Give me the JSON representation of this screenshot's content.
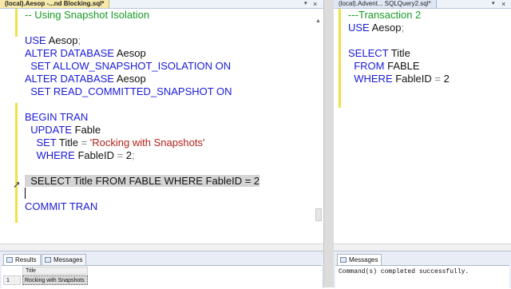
{
  "left_editor": {
    "tab_title": "(local).Aesop -...nd Blocking.sql*",
    "lines": [
      [
        {
          "t": "-- Using Snapshot Isolation",
          "c": "cm"
        }
      ],
      [],
      [
        {
          "t": "USE",
          "c": "kw"
        },
        {
          "t": " Aesop",
          "c": "id"
        },
        {
          "t": ";",
          "c": "op"
        }
      ],
      [
        {
          "t": "ALTER DATABASE",
          "c": "kw"
        },
        {
          "t": " Aesop",
          "c": "id"
        }
      ],
      [
        {
          "t": "  SET ALLOW_SNAPSHOT_ISOLATION ON",
          "c": "kw"
        }
      ],
      [
        {
          "t": "ALTER DATABASE",
          "c": "kw"
        },
        {
          "t": " Aesop",
          "c": "id"
        }
      ],
      [
        {
          "t": "  SET READ_COMMITTED_SNAPSHOT ON",
          "c": "kw"
        }
      ],
      [],
      [
        {
          "t": "BEGIN TRAN",
          "c": "kw"
        }
      ],
      [
        {
          "t": "  UPDATE",
          "c": "kw"
        },
        {
          "t": " Fable",
          "c": "id"
        }
      ],
      [
        {
          "t": "    SET",
          "c": "kw"
        },
        {
          "t": " Title ",
          "c": "id"
        },
        {
          "t": "=",
          "c": "op"
        },
        {
          "t": " 'Rocking with Snapshots'",
          "c": "st"
        }
      ],
      [
        {
          "t": "    WHERE",
          "c": "kw"
        },
        {
          "t": " FableID ",
          "c": "id"
        },
        {
          "t": "=",
          "c": "op"
        },
        {
          "t": " 2",
          "c": "id"
        },
        {
          "t": ";",
          "c": "op"
        }
      ],
      [],
      [
        {
          "t": "  SELECT Title FROM FABLE WHERE FableID = 2",
          "c": "id",
          "sel": true
        }
      ],
      [],
      [
        {
          "t": "COMMIT TRAN",
          "c": "kw"
        }
      ]
    ]
  },
  "right_editor": {
    "tab_title": "(local).Advent... SQLQuery2.sql*",
    "lines": [
      [
        {
          "t": "---Transaction 2",
          "c": "cm"
        }
      ],
      [
        {
          "t": "USE",
          "c": "kw"
        },
        {
          "t": " Aesop",
          "c": "id"
        },
        {
          "t": ";",
          "c": "op"
        }
      ],
      [],
      [
        {
          "t": "SELECT",
          "c": "kw"
        },
        {
          "t": " Title",
          "c": "id"
        }
      ],
      [
        {
          "t": "  FROM",
          "c": "kw"
        },
        {
          "t": " FABLE",
          "c": "id"
        }
      ],
      [
        {
          "t": "  WHERE",
          "c": "kw"
        },
        {
          "t": " FableID ",
          "c": "id"
        },
        {
          "t": "=",
          "c": "op"
        },
        {
          "t": " 2",
          "c": "id"
        }
      ]
    ]
  },
  "results": {
    "tabs": [
      "Results",
      "Messages"
    ],
    "column_header": "Title",
    "row_number": "1",
    "cell_value": "Rocking with Snapshots"
  },
  "right_results": {
    "tab": "Messages",
    "message": "Command(s) completed successfully."
  }
}
